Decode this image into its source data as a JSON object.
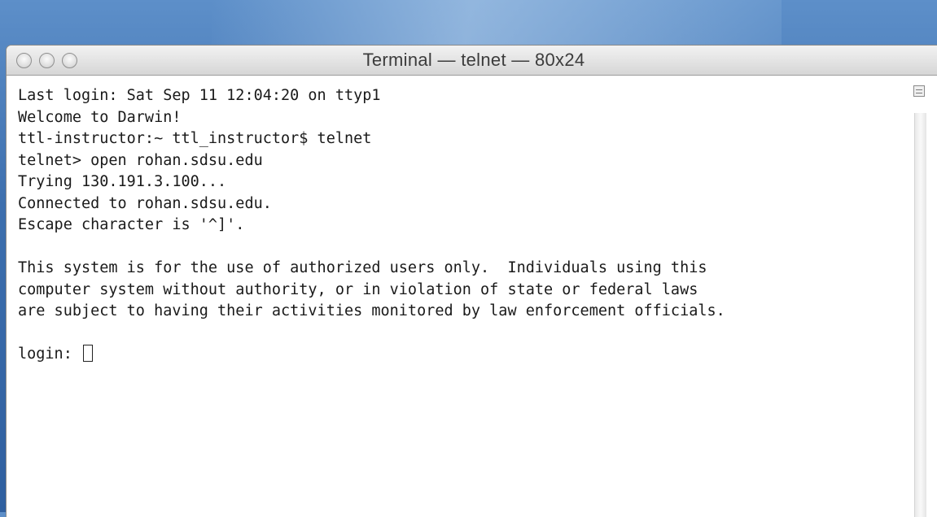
{
  "window": {
    "title": "Terminal — telnet — 80x24",
    "buttons": {
      "close": "close-button",
      "minimize": "minimize-button",
      "zoom": "zoom-button"
    }
  },
  "terminal": {
    "lines": [
      "Last login: Sat Sep 11 12:04:20 on ttyp1",
      "Welcome to Darwin!",
      "ttl-instructor:~ ttl_instructor$ telnet",
      "telnet> open rohan.sdsu.edu",
      "Trying 130.191.3.100...",
      "Connected to rohan.sdsu.edu.",
      "Escape character is '^]'.",
      "",
      "This system is for the use of authorized users only.  Individuals using this",
      "computer system without authority, or in violation of state or federal laws",
      "are subject to having their activities monitored by law enforcement officials.",
      ""
    ],
    "prompt": "login: "
  },
  "icons": {
    "resize": "resize-widget-icon",
    "cursor": "cursor-block"
  }
}
